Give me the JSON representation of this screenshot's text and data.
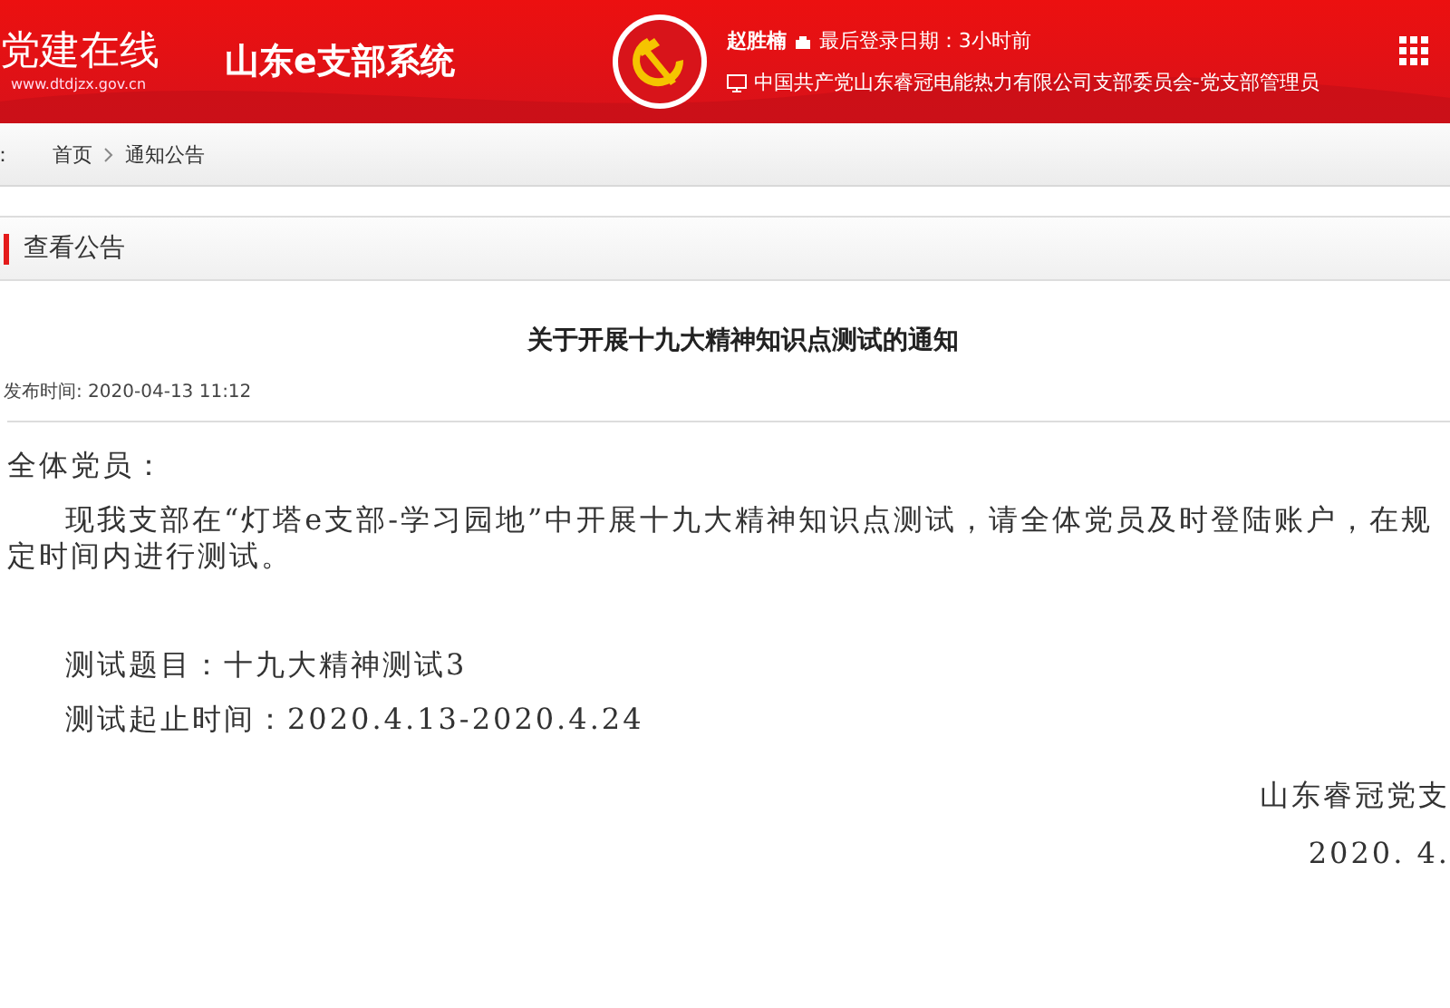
{
  "header": {
    "logo_text": "党建在线",
    "logo_url": "www.dtdjzx.gov.cn",
    "system_title": "山东e支部系统",
    "user_name": "赵胜楠",
    "last_login": "最后登录日期：3小时前",
    "organization": "中国共产党山东睿冠电能热力有限公司支部委员会-党支部管理员"
  },
  "breadcrumb": {
    "label": "：",
    "items": [
      {
        "text": "首页"
      },
      {
        "text": "通知公告"
      }
    ]
  },
  "panel": {
    "title": "查看公告"
  },
  "notice": {
    "title": "关于开展十九大精神知识点测试的通知",
    "published": "发布时间: 2020-04-13 11:12",
    "paragraphs": [
      {
        "kind": "plain",
        "text": "全体党员："
      },
      {
        "kind": "indent",
        "text": "现我支部在“灯塔e支部-学习园地”中开展十九大精神知识点测试，请全体党员及时登陆账户，在规定时间内进行测试。"
      },
      {
        "kind": "gap"
      },
      {
        "kind": "indent",
        "text": "测试题目：十九大精神测试3"
      },
      {
        "kind": "indent",
        "text": "测试起止时间：2020.4.13-2020.4.24"
      }
    ],
    "signature": [
      "山东睿冠党支",
      "2020. 4."
    ]
  }
}
